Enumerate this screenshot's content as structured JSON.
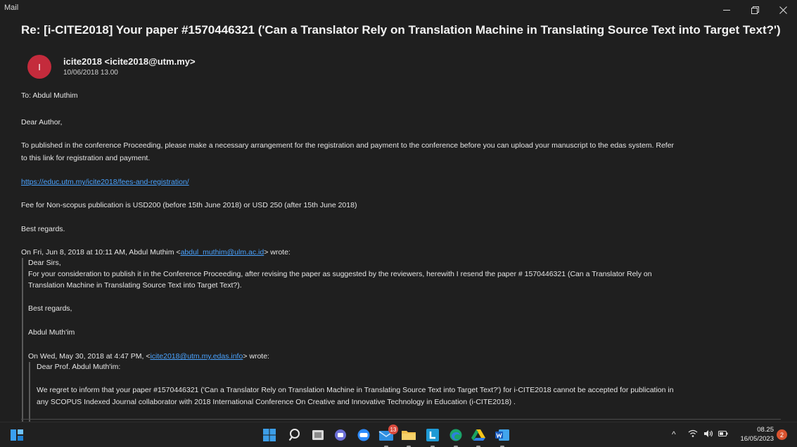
{
  "window": {
    "title": "Mail"
  },
  "email": {
    "subject": "Re: [i-CITE2018] Your paper #1570446321 ('Can a Translator Rely on Translation Machine in Translating Source Text into Target Text?')",
    "avatar_initial": "I",
    "sender": "icite2018 <icite2018@utm.my>",
    "date": "10/06/2018 13.00",
    "to": "To: Abdul Muthim",
    "greeting": "Dear Author,",
    "para1_line1": "To published in the conference Proceeding, please make a necessary arrangement for the registration and payment to the conference before you can upload your manuscript to the edas system. Refer",
    "para1_line2": "to this link for registration and payment.",
    "link": "https://educ.utm.my/icite2018/fees-and-registration/",
    "fee": "Fee for Non-scopus publication is USD200 (before 15th June 2018) or USD 250 (after 15th June 2018)",
    "closing": "Best regards.",
    "quote1": {
      "header_prefix": "On Fri, Jun 8, 2018 at 10:11 AM, Abdul Muthim <",
      "header_email": "abdul_muthim@ulm.ac.id",
      "header_suffix": "> wrote:",
      "salutation": "Dear Sirs,",
      "body_line1": "For your consideration to publish it in the Conference Proceeding, after revising the paper as suggested by the reviewers, herewith I resend the paper # 1570446321 (Can a Translator Rely on",
      "body_line2": "Translation Machine in Translating Source Text into Target Text?).",
      "closing": "Best regards,",
      "signature": "Abdul Muth'im"
    },
    "quote2": {
      "header_prefix": "On Wed, May 30, 2018 at 4:47 PM, <",
      "header_email": "icite2018@utm.my.edas.info",
      "header_suffix": "> wrote:",
      "salutation": "Dear Prof. Abdul Muth'im:",
      "body_line1": "We regret to inform that your paper #1570446321 ('Can a Translator Rely on Translation Machine in Translating Source Text into Target Text?') for i-CITE2018 cannot be accepted for publication in",
      "body_line2": "any SCOPUS Indexed Journal collaborator with 2018 International Conference On Creative and Innovative Technology in Education (i-CITE2018) ."
    }
  },
  "taskbar": {
    "mail_badge": "13",
    "clock_time": "08.25",
    "clock_date": "16/05/2023",
    "notification_count": "2",
    "icons": [
      "widgets-icon",
      "start-icon",
      "search-icon",
      "task-view-icon",
      "chat-icon",
      "zoom-icon",
      "mail-icon",
      "file-explorer-icon",
      "l-app-icon",
      "edge-icon",
      "google-drive-icon",
      "word-icon"
    ]
  },
  "colors": {
    "background": "#1f1f1f",
    "link": "#4aa3ff",
    "avatar": "#c42b3c",
    "taskbar": "#202020"
  }
}
